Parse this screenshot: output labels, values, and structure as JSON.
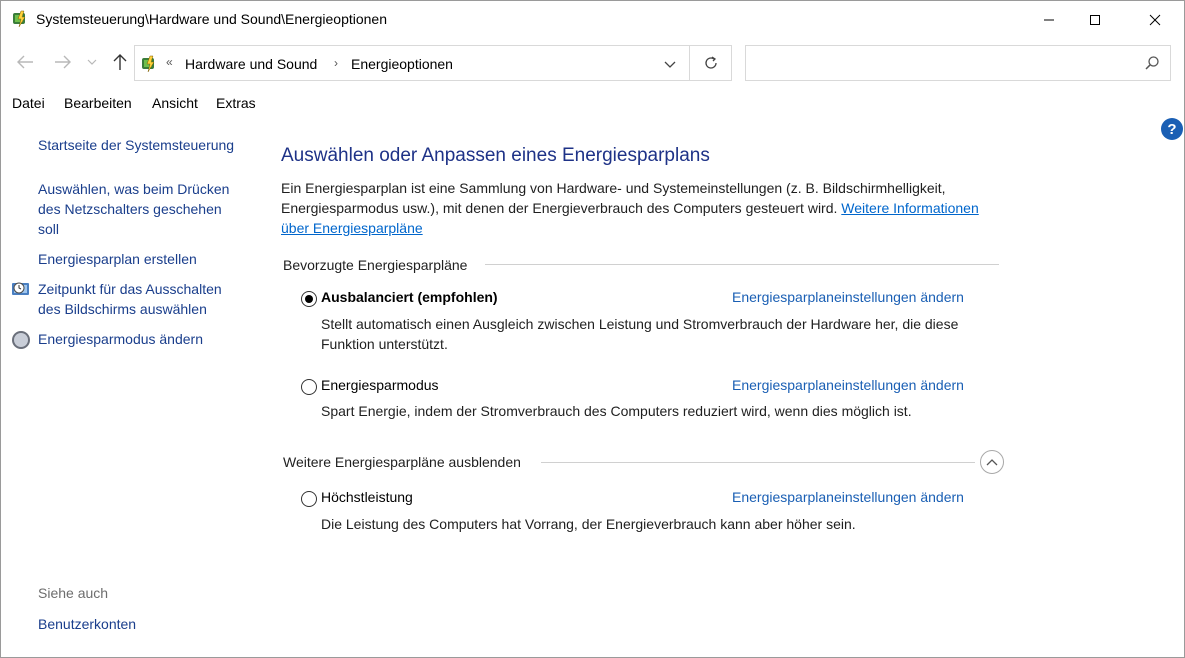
{
  "window": {
    "title": "Systemsteuerung\\Hardware und Sound\\Energieoptionen"
  },
  "address": {
    "overflow_chevrons": "«",
    "crumbs": [
      "Hardware und Sound",
      "Energieoptionen"
    ],
    "separator": "›",
    "search_placeholder": ""
  },
  "menu": [
    "Datei",
    "Bearbeiten",
    "Ansicht",
    "Extras"
  ],
  "help_label": "?",
  "sidebar": {
    "links": [
      "Startseite der Systemsteuerung",
      "Auswählen, was beim Drücken\ndes Netzschalters geschehen\nsoll",
      "Energiesparplan erstellen",
      "Zeitpunkt für das Ausschalten\ndes Bildschirms auswählen",
      "Energiesparmodus ändern"
    ],
    "see_also_heading": "Siehe auch",
    "see_also_links": [
      "Benutzerkonten"
    ]
  },
  "main": {
    "heading": "Auswählen oder Anpassen eines Energiesparplans",
    "description": "Ein Energiesparplan ist eine Sammlung von Hardware- und Systemeinstellungen (z. B. Bildschirmhelligkeit, Energiesparmodus usw.), mit denen der Energieverbrauch des Computers gesteuert wird. ",
    "more_info_link": "Weitere Informationen über Energiesparpläne",
    "preferred_section": "Bevorzugte Energiesparpläne",
    "more_section": "Weitere Energiesparpläne ausblenden",
    "plans": [
      {
        "name": "Ausbalanciert (empfohlen)",
        "selected": true,
        "link": "Energiesparplaneinstellungen ändern",
        "description": "Stellt automatisch einen Ausgleich zwischen Leistung und Stromverbrauch der Hardware her, die diese Funktion unterstützt."
      },
      {
        "name": "Energiesparmodus",
        "selected": false,
        "link": "Energiesparplaneinstellungen ändern",
        "description": "Spart Energie, indem der Stromverbrauch des Computers reduziert wird, wenn dies möglich ist."
      },
      {
        "name": "Höchstleistung",
        "selected": false,
        "link": "Energiesparplaneinstellungen ändern",
        "description": "Die Leistung des Computers hat Vorrang, der Energieverbrauch kann aber höher sein."
      }
    ]
  },
  "colors": {
    "link": "#1a5fb4",
    "heading": "#1e3287",
    "sidebar_link": "#1a3e8c"
  }
}
